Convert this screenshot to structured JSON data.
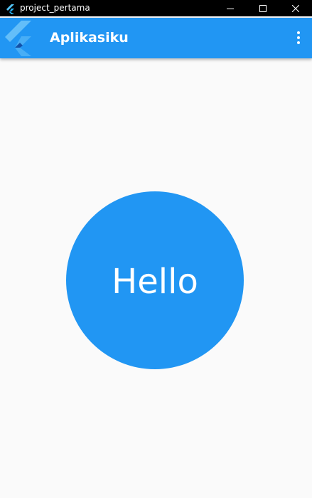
{
  "window": {
    "title": "project_pertama",
    "icons": [
      "flutter-icon",
      "minimize-icon",
      "maximize-icon",
      "close-icon"
    ]
  },
  "appbar": {
    "title": "Aplikasiku",
    "menu_icon": "more-vert-icon",
    "color": "#2196f3"
  },
  "body": {
    "circle_text": "Hello",
    "circle_color": "#2196f3",
    "background": "#fafafa"
  }
}
